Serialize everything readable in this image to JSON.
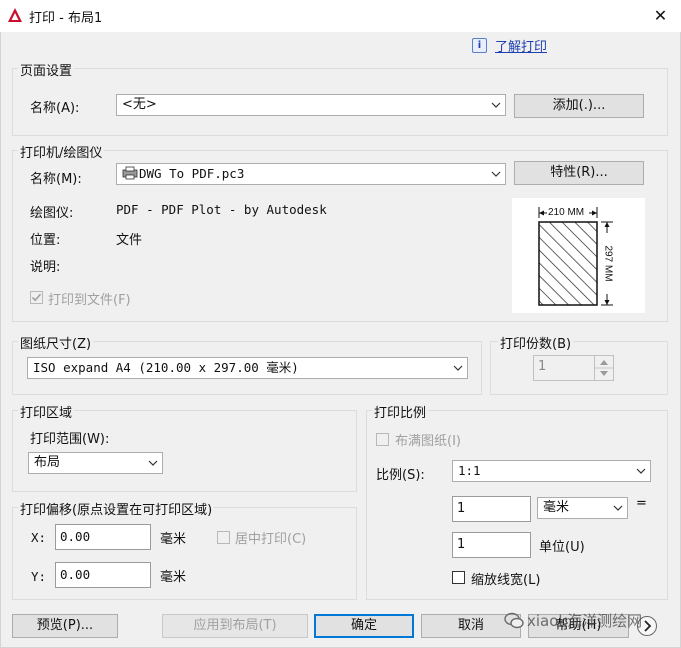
{
  "window": {
    "title": "打印 - 布局1",
    "close": "✕"
  },
  "help_link": "了解打印",
  "page_setup": {
    "title": "页面设置",
    "name_label": "名称(A):",
    "name_value": "<无>",
    "add_button": "添加(.)..."
  },
  "printer": {
    "title": "打印机/绘图仪",
    "name_label": "名称(M):",
    "name_value": "DWG To PDF.pc3",
    "properties_button": "特性(R)...",
    "plotter_label": "绘图仪:",
    "plotter_value": "PDF - PDF Plot - by Autodesk",
    "location_label": "位置:",
    "location_value": "文件",
    "description_label": "说明:",
    "plot_to_file_label": "打印到文件(F)",
    "plot_to_file_checked": true,
    "preview_width": "210 MM",
    "preview_height": "297 MM"
  },
  "paper_size": {
    "title": "图纸尺寸(Z)",
    "value": "ISO expand A4 (210.00 x 297.00 毫米)"
  },
  "copies": {
    "title": "打印份数(B)",
    "value": "1"
  },
  "plot_area": {
    "title": "打印区域",
    "range_label": "打印范围(W):",
    "range_value": "布局"
  },
  "plot_scale": {
    "title": "打印比例",
    "fit_label": "布满图纸(I)",
    "scale_label": "比例(S):",
    "scale_value": "1:1",
    "value1": "1",
    "unit_value": "毫米",
    "equals": "=",
    "value2": "1",
    "unit_label": "单位(U)",
    "scale_lineweights_label": "缩放线宽(L)"
  },
  "plot_offset": {
    "title": "打印偏移(原点设置在可打印区域)",
    "x_label": "X:",
    "x_value": "0.00",
    "x_unit": "毫米",
    "y_label": "Y:",
    "y_value": "0.00",
    "y_unit": "毫米",
    "center_label": "居中打印(C)"
  },
  "footer": {
    "preview_button": "预览(P)...",
    "apply_button": "应用到布局(T)",
    "ok_button": "确定",
    "cancel_button": "取消",
    "help_button": "帮助(H)"
  },
  "watermark": "xiaok海洋测绘网",
  "colors": {
    "accent": "#0078d7",
    "app_icon": "#c8102e",
    "link": "#1f3fb0"
  }
}
